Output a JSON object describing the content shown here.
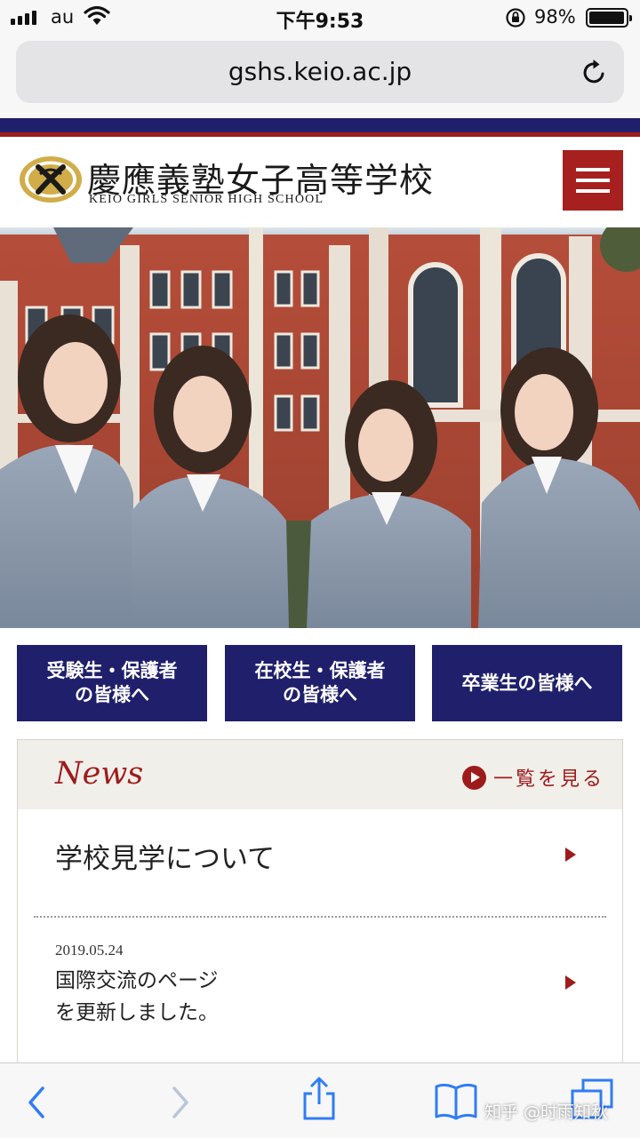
{
  "status_bar": {
    "carrier": "au",
    "time": "下午9:53",
    "battery_percent": "98%",
    "battery_level": 0.98
  },
  "browser": {
    "url": "gshs.keio.ac.jp"
  },
  "site_header": {
    "name_jp": "慶應義塾女子高等学校",
    "name_en": "KEIO GIRLS SENIOR HIGH SCHOOL"
  },
  "audience_links": [
    {
      "label": "受験生・保護者\nの皆様へ"
    },
    {
      "label": "在校生・保護者\nの皆様へ"
    },
    {
      "label": "卒業生の皆様へ"
    }
  ],
  "news": {
    "title": "News",
    "more_label": "一覧を見る",
    "items": [
      {
        "date": "",
        "text": "学校見学について"
      },
      {
        "date": "2019.05.24",
        "text": "国際交流のページ\nを更新しました。"
      }
    ]
  },
  "watermark": "知乎 @时雨知秋",
  "colors": {
    "navy": "#1f1f6b",
    "crimson": "#9e1b1b",
    "menu_red": "#a5201e",
    "news_header_bg": "#f1efea",
    "ios_blue": "#2f7cf6"
  },
  "icons": {
    "status": [
      "signal-icon",
      "wifi-icon",
      "orientation-lock-icon",
      "battery-icon"
    ],
    "browser": [
      "reload-icon"
    ],
    "header": [
      "school-emblem-icon",
      "hamburger-menu-icon"
    ],
    "news": [
      "play-circle-icon",
      "chevron-right-icon"
    ],
    "toolbar": [
      "back-icon",
      "forward-icon",
      "share-icon",
      "bookmarks-icon",
      "tabs-icon"
    ]
  }
}
